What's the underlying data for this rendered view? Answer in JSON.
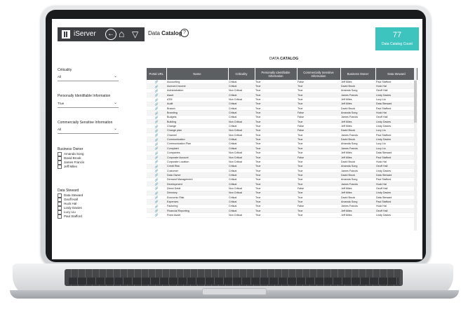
{
  "app": {
    "brand": "iServer",
    "page_title_pre": "Data ",
    "page_title_bold": "Catalog"
  },
  "kpi": {
    "value": "77",
    "label": "Data Catalog Count"
  },
  "table": {
    "title_pre": "DATA ",
    "title_bold": "CATALOG",
    "columns": [
      "Portal URL",
      "Name",
      "Criticality",
      "Personally Identifiable Information",
      "Commercially Sensitive Information",
      "Business Owner",
      "Data Steward"
    ],
    "rows": [
      [
        "Accounting",
        "Critical",
        "True",
        "False",
        "Jeff Miles",
        "Paul Stafford"
      ],
      [
        "Accrued Income",
        "Critical",
        "True",
        "True",
        "David Brook",
        "Huck Hal"
      ],
      [
        "Administration",
        "Non Critical",
        "True",
        "True",
        "Amanda Song",
        "Geoff Hall"
      ],
      [
        "Asset",
        "Critical",
        "True",
        "True",
        "James Francis",
        "Lindy Davies"
      ],
      [
        "ATM",
        "Non Critical",
        "True",
        "True",
        "Jeff Miles",
        "Lucy Liu"
      ],
      [
        "Audit",
        "Critical",
        "True",
        "True",
        "Jeff Miles",
        "Data Steward"
      ],
      [
        "Branch",
        "Critical",
        "True",
        "True",
        "David Brook",
        "Paul Stafford"
      ],
      [
        "Branding",
        "Critical",
        "True",
        "False",
        "Amanda Song",
        "Huck Hal"
      ],
      [
        "Budgets",
        "Critical",
        "True",
        "False",
        "James Francis",
        "Geoff Hall"
      ],
      [
        "Building",
        "Non Critical",
        "True",
        "True",
        "Jeff Miles",
        "Lindy Davies"
      ],
      [
        "Change",
        "Critical",
        "True",
        "False",
        "Jeff Miles",
        "Lindy Davies"
      ],
      [
        "Change plan",
        "Non Critical",
        "True",
        "False",
        "David Brook",
        "Lucy Liu"
      ],
      [
        "Channel",
        "Non Critical",
        "True",
        "True",
        "James Francis",
        "Paul Stafford"
      ],
      [
        "Communication",
        "Critical",
        "True",
        "True",
        "David Brook",
        "Lindy Davies"
      ],
      [
        "Communication Plan",
        "Critical",
        "True",
        "True",
        "Amanda Song",
        "Lucy Liu"
      ],
      [
        "Complaint",
        "Critical",
        "True",
        "True",
        "James Francis",
        "Lucy Liu"
      ],
      [
        "Companies",
        "Non Critical",
        "True",
        "True",
        "Jeff Miles",
        "Data Steward"
      ],
      [
        "Corporate Account",
        "Non Critical",
        "True",
        "False",
        "Jeff Miles",
        "Paul Stafford"
      ],
      [
        "Corporate Location",
        "Non Critical",
        "True",
        "True",
        "David Brook",
        "Huck Hal"
      ],
      [
        "Credit Risk",
        "Critical",
        "True",
        "True",
        "Amanda Song",
        "Geoff Hall"
      ],
      [
        "Customer",
        "Critical",
        "True",
        "True",
        "James Francis",
        "Lindy Davies"
      ],
      [
        "Data Owner",
        "Critical",
        "True",
        "True",
        "David Brook",
        "Data Steward"
      ],
      [
        "Demand Management",
        "Critical",
        "True",
        "True",
        "Amanda Song",
        "Paul Stafford"
      ],
      [
        "Development",
        "Critical",
        "True",
        "True",
        "James Francis",
        "Huck Hal"
      ],
      [
        "Direct Debit",
        "Non Critical",
        "True",
        "False",
        "Jeff Miles",
        "Geoff Hall"
      ],
      [
        "Directory",
        "Non Critical",
        "True",
        "True",
        "Jeff Miles",
        "Lindy Davies"
      ],
      [
        "Economic Risk",
        "Critical",
        "True",
        "True",
        "David Brook",
        "Data Steward"
      ],
      [
        "Expenses",
        "Critical",
        "True",
        "True",
        "Amanda Song",
        "Paul Stafford"
      ],
      [
        "Factoring",
        "Critical",
        "True",
        "False",
        "James Francis",
        "Huck Hal"
      ],
      [
        "Financial Reporting",
        "Critical",
        "True",
        "True",
        "Jeff Miles",
        "Geoff Hall"
      ],
      [
        "Fixed Asset",
        "Non Critical",
        "True",
        "True",
        "Jeff Miles",
        "Lindy Davies"
      ]
    ]
  },
  "filters": {
    "criticality": {
      "label": "Criticality",
      "value": "All"
    },
    "pii": {
      "label": "Personally Identifiable Information",
      "value": "True"
    },
    "csi": {
      "label": "Commercially Sensitive Information",
      "value": "All"
    },
    "business_owner": {
      "label": "Business Owner",
      "items": [
        "Amanda Song",
        "David Brook",
        "James Francis",
        "Jeff Miles"
      ]
    },
    "data_steward": {
      "label": "Data Steward",
      "items": [
        "Data Steward",
        "Geoff Hall",
        "Huck Hal",
        "Lindy Davies",
        "Lucy Liu",
        "Paul Stafford"
      ]
    }
  }
}
